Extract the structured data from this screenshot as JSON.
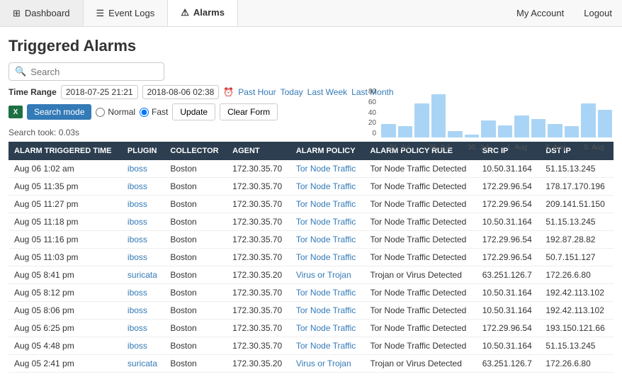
{
  "nav": {
    "tabs": [
      {
        "label": "Dashboard",
        "icon": "⊞",
        "active": false
      },
      {
        "label": "Event Logs",
        "icon": "☰",
        "active": false
      },
      {
        "label": "Alarms",
        "icon": "⚠",
        "active": true
      }
    ],
    "right_links": [
      "My Account",
      "Logout"
    ]
  },
  "page": {
    "title": "Triggered Alarms"
  },
  "search": {
    "placeholder": "Search",
    "value": ""
  },
  "time_range": {
    "label": "Time Range",
    "start": "2018-07-25 21:21",
    "end": "2018-08-06 02:38",
    "links": [
      "Past Hour",
      "Today",
      "Last Week",
      "Last Month"
    ]
  },
  "controls": {
    "search_mode_label": "Search mode",
    "normal_label": "Normal",
    "fast_label": "Fast",
    "update_label": "Update",
    "clear_label": "Clear Form"
  },
  "search_took": "Search took: 0.03s",
  "chart": {
    "y_labels": [
      "80",
      "60",
      "40",
      "20",
      "0"
    ],
    "bars": [
      22,
      18,
      55,
      70,
      10,
      5,
      28,
      20,
      35,
      30,
      22,
      18,
      55,
      45
    ],
    "x_labels": [
      "26. Jul",
      "28. Jul",
      "30. Jul",
      "1. Aug",
      "3. Aug",
      "5. Aug"
    ]
  },
  "table": {
    "headers": [
      "ALARM TRIGGERED TIME",
      "PLUGIN",
      "COLLECTOR",
      "AGENT",
      "ALARM POLICY",
      "ALARM POLICY RULE",
      "SRC IP",
      "DST IP"
    ],
    "rows": [
      [
        "Aug 06 1:02 am",
        "iboss",
        "Boston",
        "172.30.35.70",
        "Tor Node Traffic",
        "Tor Node Traffic Detected",
        "10.50.31.164",
        "51.15.13.245"
      ],
      [
        "Aug 05 11:35 pm",
        "iboss",
        "Boston",
        "172.30.35.70",
        "Tor Node Traffic",
        "Tor Node Traffic Detected",
        "172.29.96.54",
        "178.17.170.196"
      ],
      [
        "Aug 05 11:27 pm",
        "iboss",
        "Boston",
        "172.30.35.70",
        "Tor Node Traffic",
        "Tor Node Traffic Detected",
        "172.29.96.54",
        "209.141.51.150"
      ],
      [
        "Aug 05 11:18 pm",
        "iboss",
        "Boston",
        "172.30.35.70",
        "Tor Node Traffic",
        "Tor Node Traffic Detected",
        "10.50.31.164",
        "51.15.13.245"
      ],
      [
        "Aug 05 11:16 pm",
        "iboss",
        "Boston",
        "172.30.35.70",
        "Tor Node Traffic",
        "Tor Node Traffic Detected",
        "172.29.96.54",
        "192.87.28.82"
      ],
      [
        "Aug 05 11:03 pm",
        "iboss",
        "Boston",
        "172.30.35.70",
        "Tor Node Traffic",
        "Tor Node Traffic Detected",
        "172.29.96.54",
        "50.7.151.127"
      ],
      [
        "Aug 05 8:41 pm",
        "suricata",
        "Boston",
        "172.30.35.20",
        "Virus or Trojan",
        "Trojan or Virus Detected",
        "63.251.126.7",
        "172.26.6.80"
      ],
      [
        "Aug 05 8:12 pm",
        "iboss",
        "Boston",
        "172.30.35.70",
        "Tor Node Traffic",
        "Tor Node Traffic Detected",
        "10.50.31.164",
        "192.42.113.102"
      ],
      [
        "Aug 05 8:06 pm",
        "iboss",
        "Boston",
        "172.30.35.70",
        "Tor Node Traffic",
        "Tor Node Traffic Detected",
        "10.50.31.164",
        "192.42.113.102"
      ],
      [
        "Aug 05 6:25 pm",
        "iboss",
        "Boston",
        "172.30.35.70",
        "Tor Node Traffic",
        "Tor Node Traffic Detected",
        "172.29.96.54",
        "193.150.121.66"
      ],
      [
        "Aug 05 4:48 pm",
        "iboss",
        "Boston",
        "172.30.35.70",
        "Tor Node Traffic",
        "Tor Node Traffic Detected",
        "10.50.31.164",
        "51.15.13.245"
      ],
      [
        "Aug 05 2:41 pm",
        "suricata",
        "Boston",
        "172.30.35.20",
        "Virus or Trojan",
        "Trojan or Virus Detected",
        "63.251.126.7",
        "172.26.6.80"
      ]
    ]
  }
}
